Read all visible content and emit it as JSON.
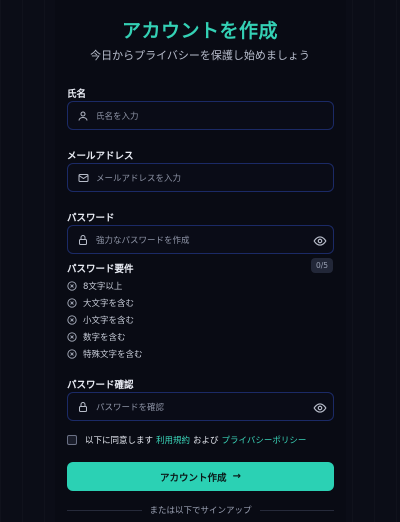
{
  "header": {
    "title": "アカウントを作成",
    "subtitle": "今日からプライバシーを保護し始めましょう"
  },
  "fields": {
    "name": {
      "label": "氏名",
      "placeholder": "氏名を入力"
    },
    "email": {
      "label": "メールアドレス",
      "placeholder": "メールアドレスを入力"
    },
    "password": {
      "label": "パスワード",
      "placeholder": "強力なパスワードを作成"
    },
    "confirm": {
      "label": "パスワード確認",
      "placeholder": "パスワードを確認"
    }
  },
  "requirements": {
    "title": "パスワード要件",
    "badge": "0/5",
    "items": [
      "8文字以上",
      "大文字を含む",
      "小文字を含む",
      "数字を含む",
      "特殊文字を含む"
    ]
  },
  "agreement": {
    "prefix": "以下に同意します",
    "terms": "利用規約",
    "and": "および",
    "privacy": "プライバシーポリシー"
  },
  "submit": {
    "label": "アカウント作成"
  },
  "footer": {
    "divider_text": "または以下でサインアップ"
  },
  "colors": {
    "accent": "#2bd1b4",
    "background": "#0b0d17",
    "field_border": "#1b2a66"
  },
  "icons": {
    "name": "user-icon",
    "email": "mail-icon",
    "password": "lock-icon",
    "visibility": "eye-icon",
    "requirement": "circle-x-icon",
    "submit": "arrow-right-icon"
  }
}
